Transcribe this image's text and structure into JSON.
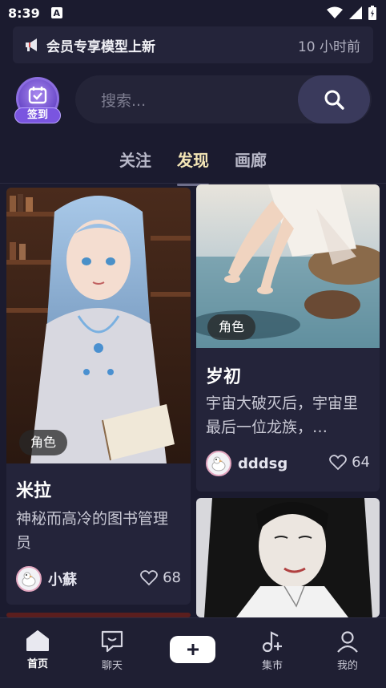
{
  "status": {
    "time": "8:39",
    "a_icon_letter": "A"
  },
  "notice": {
    "icon": "megaphone-icon",
    "text": "会员专享模型上新",
    "time": "10 小时前"
  },
  "checkin": {
    "label": "签到"
  },
  "search": {
    "placeholder": "搜索..."
  },
  "tabs": [
    {
      "label": "关注",
      "active": false
    },
    {
      "label": "发现",
      "active": true
    },
    {
      "label": "画廊",
      "active": false
    }
  ],
  "cards": [
    {
      "badge": "角色",
      "title": "米拉",
      "desc": "神秘而高冷的图书管理员",
      "author": "小蘇",
      "likes": "68"
    },
    {
      "badge": "角色",
      "title": "岁初",
      "desc": "宇宙大破灭后，宇宙里最后一位龙族，…",
      "author": "dddsg",
      "likes": "64"
    }
  ],
  "nav": [
    {
      "label": "首页",
      "icon": "home-icon",
      "active": true
    },
    {
      "label": "聊天",
      "icon": "chat-icon",
      "active": false
    },
    {
      "label": "",
      "icon": "plus-icon",
      "active": false
    },
    {
      "label": "集市",
      "icon": "music-market-icon",
      "active": false
    },
    {
      "label": "我的",
      "icon": "profile-icon",
      "active": false
    }
  ],
  "colors": {
    "background": "#1b1b2f",
    "card": "#24243a",
    "active_tab": "#f4e6b6",
    "checkin": "#7a55e0"
  }
}
